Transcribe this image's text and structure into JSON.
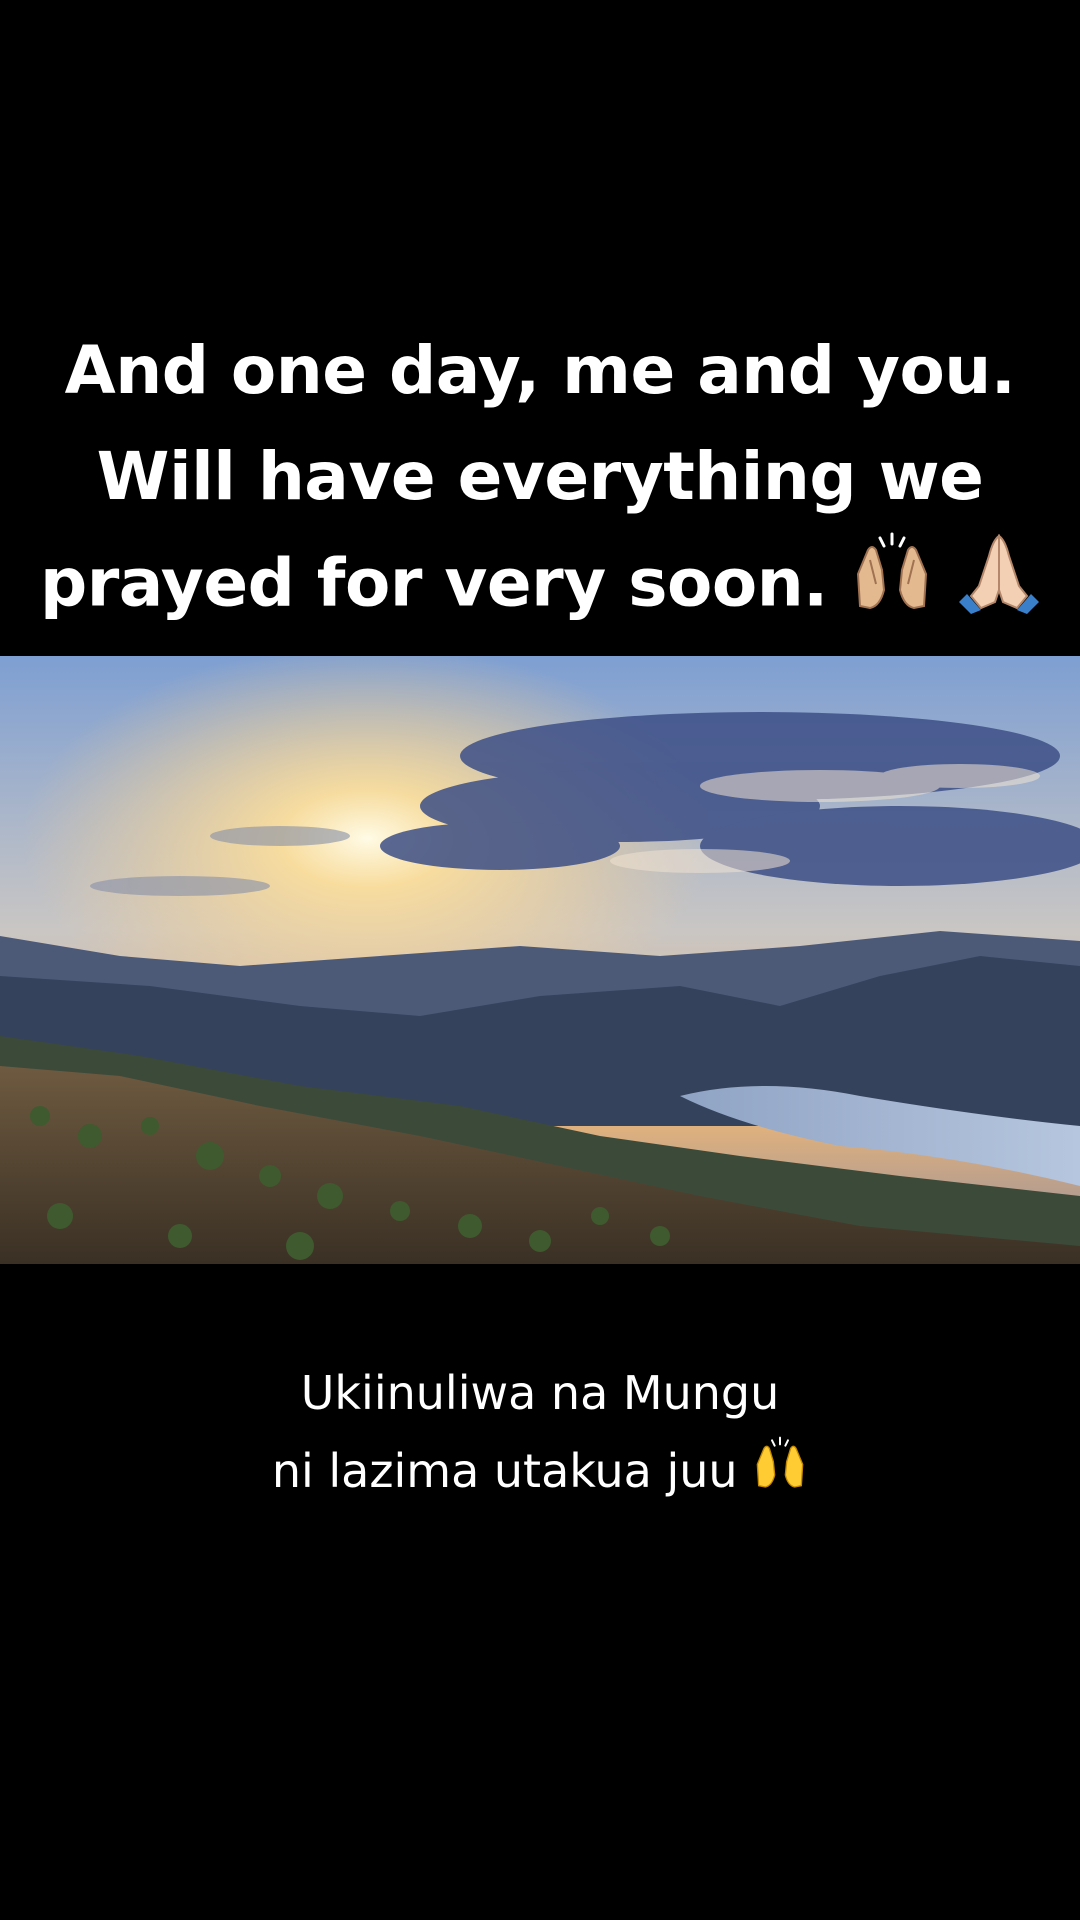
{
  "overlay_text": {
    "line1": "And one day, me and you.",
    "line2": "Will have everything we",
    "line3": "prayed for very soon.",
    "emoji1_icon": "raising-hands-light-skin-icon",
    "emoji2_icon": "folded-hands-light-skin-icon"
  },
  "photo": {
    "subject": "sunset over mountains and lake",
    "colors": {
      "sky_top": "#6f8fc4",
      "sun_glow": "#ffd98a",
      "clouds": "#3d4f86",
      "mountains_far": "#3f4f6e",
      "mountains_near": "#2e3b4e",
      "lake": "#9fb4d4",
      "hill_foreground": "#5a4a36"
    }
  },
  "subtitle": {
    "line1": "Ukiinuliwa na Mungu",
    "line2": "ni lazima utakua juu",
    "emoji_icon": "raising-hands-icon"
  }
}
